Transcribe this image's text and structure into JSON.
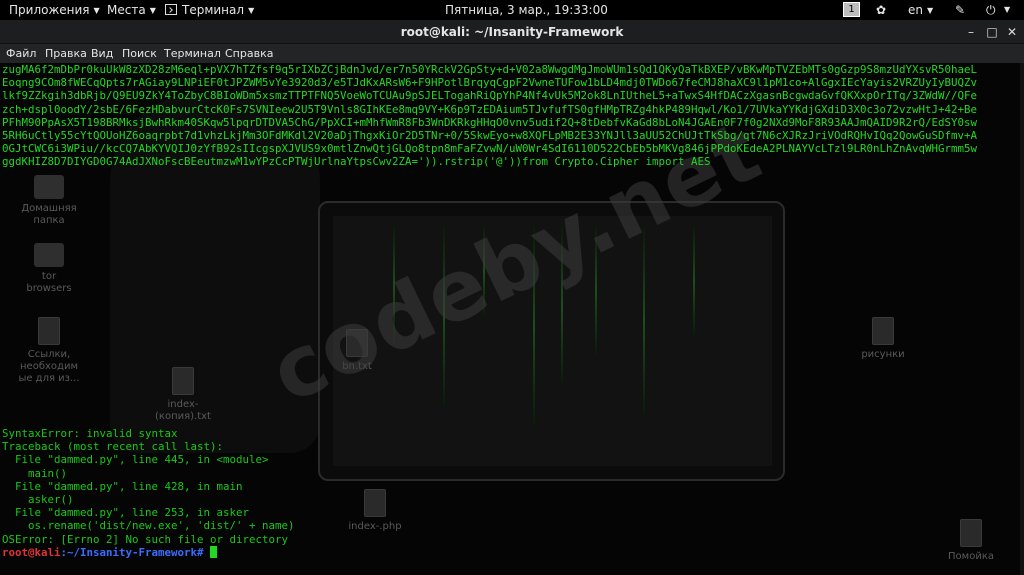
{
  "topbar": {
    "apps_label": "Приложения",
    "places_label": "Места",
    "terminal_label": "Терминал",
    "clock": "Пятница,  3 мар., 19:33:00",
    "workspace": "1",
    "lang": "en"
  },
  "window": {
    "title": "root@kali: ~/Insanity-Framework"
  },
  "menu": {
    "file": "Файл",
    "edit": "Правка",
    "view": "Вид",
    "search": "Поиск",
    "terminal": "Терминал",
    "help": "Справка"
  },
  "desktop": {
    "home": "Домашняя\nпапка",
    "tor": "tor\nbrowsers",
    "links": "Ссылки,\nнеобходим\nые для из...",
    "index_copy": "index-\n(копия).txt",
    "bn": "bn.txt",
    "index_php": "index-.php",
    "pictures": "рисунки",
    "trash": "Помойка"
  },
  "watermark": "codeby.net",
  "terminal": {
    "b64_lines": [
      "zugMA6f2mDbPr0kuUkW8zXD28zM6eql+pVX7hTZfsf9q5rIXbZCjBdnJvd/er7n50YRckV2GpSty+d+V02a8WwgdMgJmoWUm1sQd1QKyQaTkBXEP/vBKwMpTVZEbMTs0gGzp9S8mzUdYXsvR50haeL",
      "Eoqng9COm8fWECqQpts7rAGiay9LNPiEF0tJPZWM5vYe3920d3/e5TJdKxARsW6+F9HPotlBrqyqCgpF2VwneTUFow1bLD4mdj0TWDo67feCMJ8haXC9l1pM1co+AlGgxIEcYayis2VRZUyIyBUQZv",
      "lkf9ZZkgih3dbRjb/Q9EU9ZkY4ToZbyC8BIoWDm5xsmzTTPTFNQ5VoeWoTCUAu9pSJELTogahRiQpYhP4Nf4vUk5M2ok8LnIUtheL5+aTwxS4HfDACzXgasnBcgwdaGvfQKXxpOrITq/3ZWdW//QFe",
      "zch+dspl0oodY/2sbE/6FezHDabvurCtcK0Fs7SVNIeew2U5T9Vnls8GIhKEe8mq9VY+K6p9TzEDAium5TJvfufTS0gfHMpTRZg4hkP489Hqwl/Ko1/7UVkaYYKdjGXdiD3X0c3o72vzwHtJ+42+Be",
      "PFhM90PpAsX5T198BRMksjBwhRkm40SKqw5lpqrDTDVA5ChG/PpXCI+mMhfWmR8Fb3WnDKRkgHHqO0vnv5udif2Q+8tDebfvKaGd8bLoN4JGAEn0F7f0g2NXd9MoF8R93AAJmQAID9R2rQ/EdSY0sw",
      "5RH6uCtly55cYtQOUoHZ6oaqrpbt7d1vhzLkjMm3OFdMKdl2V20aDjThgxKiOr2D5TNr+0/5SkwEyo+w8XQFLpMB2E33YNJll3aUU52ChUJtTkSbg/qt7N6cXJRzJriVOdRQHvIQq2QowGuSDfmv+A",
      "0GJtCWC6i3WPiu//kcCQ7AbKYVQIJ0zYfB92sIIcgspXJVUS9x0mtlZnwQtjGLQo8tpn8mFaFZvwN/uW0Wr4SdI6110D522CbEb5bMKVg846jPPdoKEdeA2PLNAYVcLTzl9LR0nLhZnAvqWHGrmm5w",
      "ggdKHIZ8D7DIYGD0G74AdJXNoFscBEeutmzwM1wYPzCcPTWjUrlnaYtpsCwv2ZA=')).rstrip('@'))from Crypto.Cipher import AES"
    ],
    "error_lines": [
      "SyntaxError: invalid syntax",
      "Traceback (most recent call last):",
      "  File \"dammed.py\", line 445, in <module>",
      "    main()",
      "  File \"dammed.py\", line 428, in main",
      "    asker()",
      "  File \"dammed.py\", line 253, in asker",
      "    os.rename('dist/new.exe', 'dist/' + name)",
      "OSError: [Errno 2] No such file or directory"
    ],
    "prompt_user": "root@kali",
    "prompt_path": ":~/Insanity-Framework#"
  }
}
